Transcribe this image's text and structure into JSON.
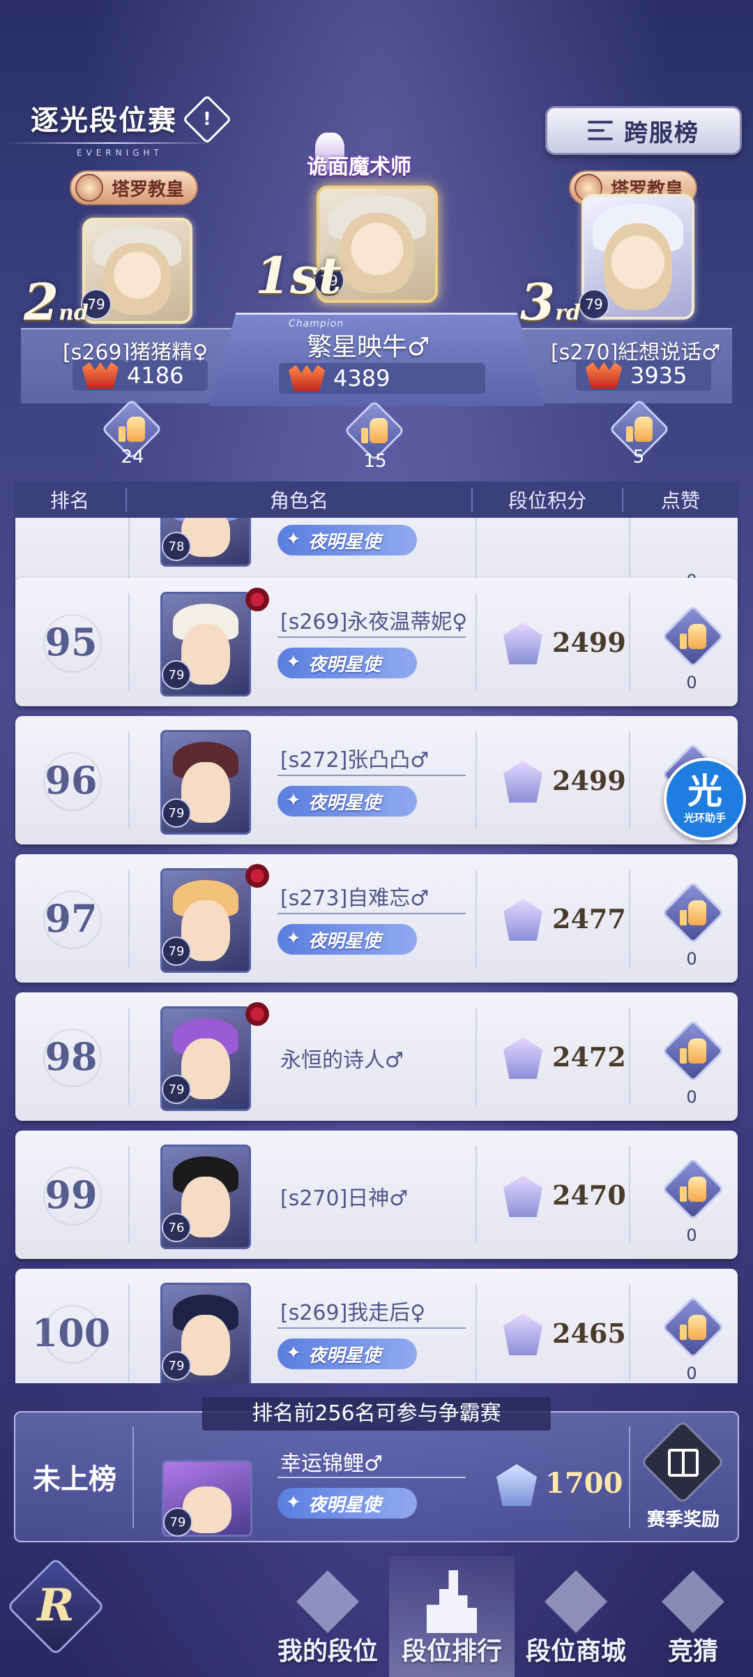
{
  "header": {
    "title": "逐光段位赛",
    "title_sub": "EVERNIGHT",
    "cross_server_button": "跨服榜"
  },
  "podium": {
    "champion_caption": "Champion",
    "first": {
      "place": "1st",
      "special_title": "诡面魔术师",
      "level": "79",
      "name": "繁星映牛♂",
      "score": "4389",
      "likes": "15"
    },
    "second": {
      "place_num": "2",
      "place_suffix": "nd",
      "class_badge": "塔罗教皇",
      "level": "79",
      "name": "[s269]猪猪精♀",
      "score": "4186",
      "likes": "24"
    },
    "third": {
      "place_num": "3",
      "place_suffix": "rd",
      "class_badge": "塔罗教皇",
      "level": "79",
      "name": "[s270]紝想说话♂",
      "score": "3935",
      "likes": "5"
    }
  },
  "table": {
    "headers": [
      "排名",
      "角色名",
      "段位积分",
      "点赞"
    ],
    "partial_row": {
      "level": "78",
      "tag": "夜明星使",
      "likes": "0"
    },
    "rows": [
      {
        "rank": "95",
        "level": "79",
        "name": "[s269]永夜温蒂妮♀",
        "tag": "夜明星使",
        "score": "2499",
        "likes": "0",
        "hair": "#f2efe6",
        "rose": true
      },
      {
        "rank": "96",
        "level": "79",
        "name": "[s272]张凸凸♂",
        "tag": "夜明星使",
        "score": "2499",
        "likes": "0",
        "hair": "#5a2a30",
        "rose": false
      },
      {
        "rank": "97",
        "level": "79",
        "name": "[s273]自难忘♂",
        "tag": "夜明星使",
        "score": "2477",
        "likes": "0",
        "hair": "#f3c27a",
        "rose": true
      },
      {
        "rank": "98",
        "level": "79",
        "name": "永恒的诗人♂",
        "tag": "",
        "score": "2472",
        "likes": "0",
        "hair": "#9b5ad6",
        "rose": true
      },
      {
        "rank": "99",
        "level": "76",
        "name": "[s270]日神♂",
        "tag": "",
        "score": "2470",
        "likes": "0",
        "hair": "#1b1b1b",
        "rose": false
      },
      {
        "rank": "100",
        "level": "79",
        "name": "[s269]我走后♀",
        "tag": "夜明星使",
        "score": "2465",
        "likes": "0",
        "hair": "#1d2246",
        "rose": false
      }
    ]
  },
  "helper_badge": {
    "icon_char": "光",
    "label": "光环助手"
  },
  "self": {
    "note": "排名前256名可参与争霸赛",
    "rank": "未上榜",
    "level": "79",
    "name": "幸运锦鲤♂",
    "tag": "夜明星使",
    "score": "1700",
    "reward_label": "赛季奖励"
  },
  "nav": {
    "logo": "R",
    "items": [
      "我的段位",
      "段位排行",
      "段位商城",
      "竞猜"
    ],
    "active_index": 1
  }
}
